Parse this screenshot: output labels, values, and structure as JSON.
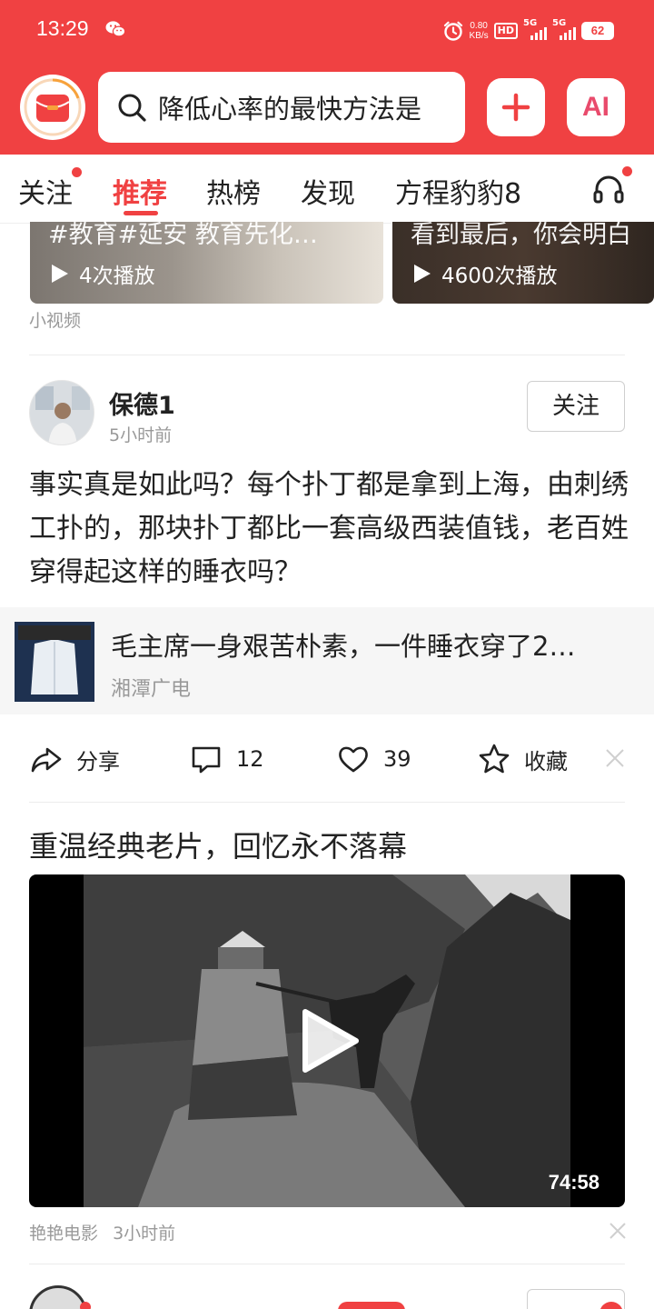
{
  "status_bar": {
    "time": "13:29",
    "net_speed_value": "0.80",
    "net_speed_unit": "KB/s",
    "hd_label": "HD",
    "signal1_label": "5G",
    "signal2_label": "5G",
    "battery": "62"
  },
  "header": {
    "search_placeholder": "降低心率的最快方法是",
    "ai_label": "AI",
    "accent_color": "#f04142"
  },
  "tabs": [
    {
      "label": "关注"
    },
    {
      "label": "推荐"
    },
    {
      "label": "热榜"
    },
    {
      "label": "发现"
    },
    {
      "label": "方程豹豹8"
    }
  ],
  "short_videos": {
    "items": [
      {
        "caption": "#教育#延安 教育先化…",
        "plays": "4次播放"
      },
      {
        "caption": "看到最后，你会明白",
        "plays": "4600次播放"
      }
    ],
    "section_label": "小视频"
  },
  "post": {
    "author": "保德1",
    "time": "5小时前",
    "follow_label": "关注",
    "text": "事实真是如此吗？每个扑丁都是拿到上海，由刺绣工扑的，那块扑丁都比一套高级西装值钱，老百姓穿得起这样的睡衣吗？",
    "quote": {
      "title": "毛主席一身艰苦朴素，一件睡衣穿了2…",
      "source": "湘潭广电"
    },
    "actions": {
      "share_label": "分享",
      "comments": "12",
      "likes": "39",
      "favorite_label": "收藏"
    }
  },
  "video_post": {
    "title": "重温经典老片，回忆永不落幕",
    "duration": "74:58",
    "source": "艳艳电影",
    "time": "3小时前"
  }
}
